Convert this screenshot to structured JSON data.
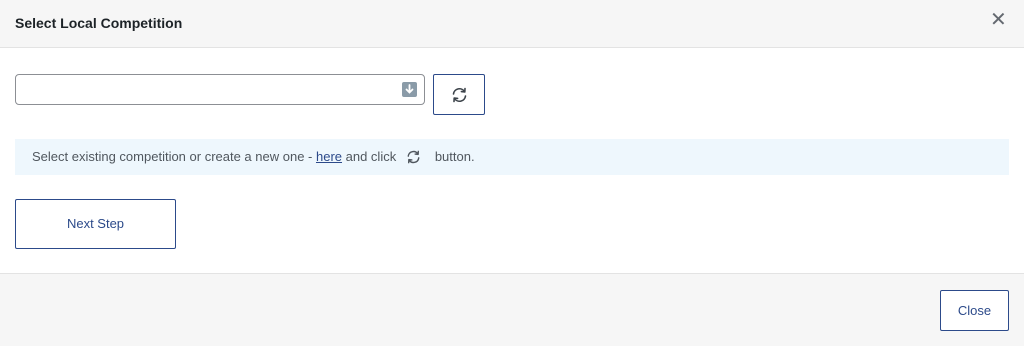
{
  "modal": {
    "title": "Select Local Competition",
    "close_icon": "close-icon"
  },
  "select": {
    "value": "",
    "arrow_icon": "arrow-down-icon"
  },
  "refresh_button": {
    "icon": "refresh-icon"
  },
  "notice": {
    "text_before": "Select existing competition or create a new one - ",
    "link_text": "here",
    "text_middle": " and click",
    "icon": "refresh-icon",
    "text_after": " button."
  },
  "next_button": {
    "label": "Next Step"
  },
  "footer": {
    "close_label": "Close"
  },
  "colors": {
    "accent": "#2c4a8a",
    "notice_bg": "#eef7fd",
    "header_bg": "#f6f6f6"
  }
}
